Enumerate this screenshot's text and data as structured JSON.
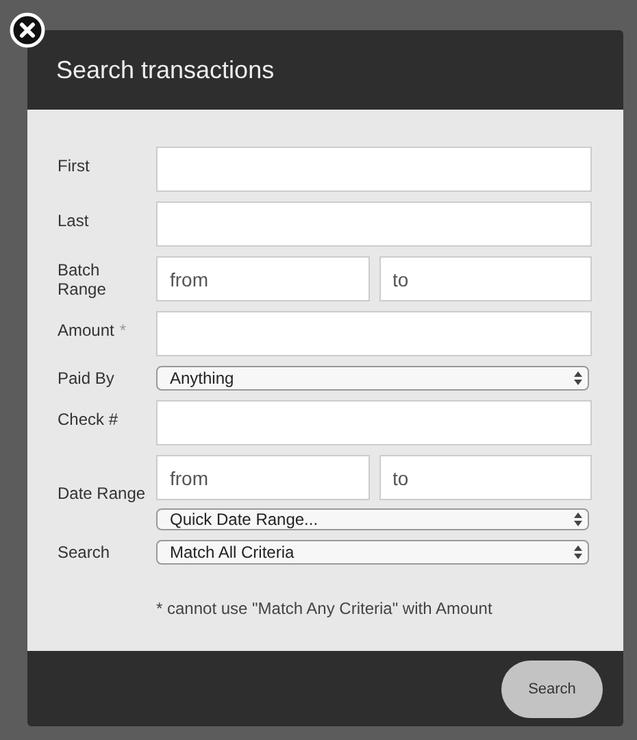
{
  "dialog": {
    "title": "Search transactions",
    "fields": [
      {
        "kind": "text",
        "label": "First"
      },
      {
        "kind": "text",
        "label": "Last"
      },
      {
        "kind": "range",
        "label": "Batch Range",
        "from_placeholder": "from",
        "to_placeholder": "to"
      },
      {
        "kind": "text",
        "label": "Amount",
        "mark": "*"
      },
      {
        "kind": "select",
        "label": "Paid By",
        "value": "Anything"
      },
      {
        "kind": "text",
        "label": "Check #"
      },
      {
        "kind": "date_range",
        "label": "Date Range",
        "from_placeholder": "from",
        "to_placeholder": "to",
        "quick_value": "Quick Date Range..."
      },
      {
        "kind": "select",
        "label": "Search",
        "value": "Match All Criteria"
      }
    ],
    "note": "* cannot use \"Match Any Criteria\" with Amount",
    "button": "Search"
  }
}
